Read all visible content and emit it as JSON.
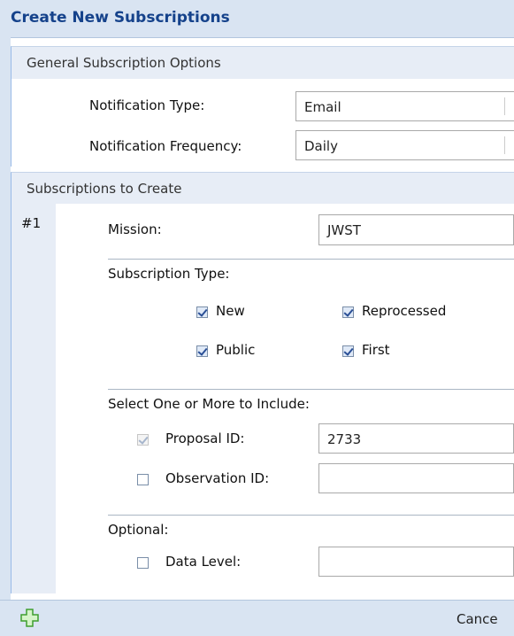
{
  "dialog": {
    "title": "Create New Subscriptions"
  },
  "general": {
    "header": "General Subscription Options",
    "notification_type_label": "Notification Type:",
    "notification_type_value": "Email",
    "notification_frequency_label": "Notification Frequency:",
    "notification_frequency_value": "Daily"
  },
  "subscriptions": {
    "header": "Subscriptions to Create",
    "index": "#1",
    "mission_label": "Mission:",
    "mission_value": "JWST",
    "subscription_type_label": "Subscription Type:",
    "types": [
      {
        "label": "New",
        "checked": true
      },
      {
        "label": "Reprocessed",
        "checked": true
      },
      {
        "label": "Public",
        "checked": true
      },
      {
        "label": "First",
        "checked": true
      }
    ],
    "include_label": "Select One or More to Include:",
    "proposal_id_label": "Proposal ID:",
    "proposal_id_value": "2733",
    "observation_id_label": "Observation ID:",
    "observation_id_value": "",
    "optional_label": "Optional:",
    "data_level_label": "Data Level:",
    "data_level_value": ""
  },
  "footer": {
    "cancel_label": "Cance"
  },
  "icons": {
    "add": "add-plus-icon"
  },
  "colors": {
    "title_text": "#15428b",
    "accent": "#99bbe8",
    "add_icon": "#4caf50"
  }
}
